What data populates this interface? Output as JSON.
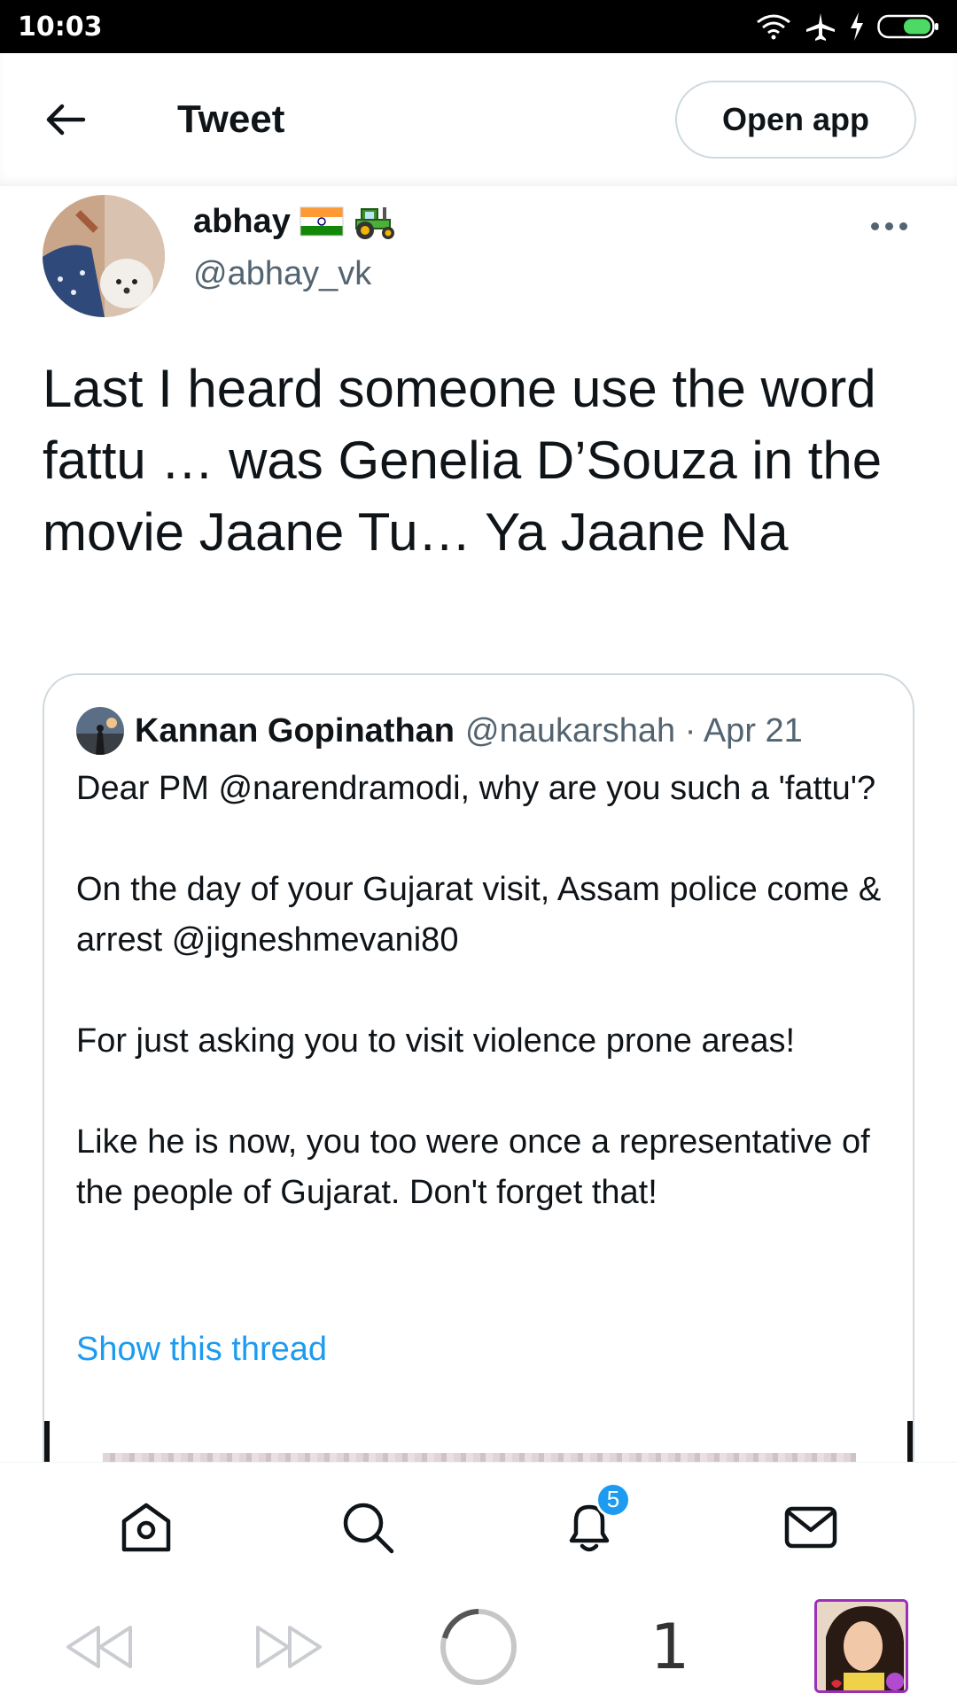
{
  "status_bar": {
    "time": "10:03",
    "icons": [
      "wifi-icon",
      "airplane-icon",
      "charging-icon",
      "battery-icon"
    ]
  },
  "header": {
    "title": "Tweet",
    "open_app_label": "Open app"
  },
  "author": {
    "name": "abhay",
    "handle": "@abhay_vk",
    "badges": [
      "india-flag-emoji",
      "tractor-emoji"
    ]
  },
  "tweet": {
    "text": "Last I heard someone use the word fattu … was Genelia D’Souza in the movie Jaane Tu… Ya Jaane Na"
  },
  "quoted": {
    "name": "Kannan Gopinathan",
    "meta": "@naukarshah · Apr 21",
    "paragraphs": [
      "Dear PM @narendramodi, why are you such a 'fattu'?",
      "On the day of your Gujarat visit, Assam police come & arrest @jigneshmevani80",
      "For just asking you to visit violence prone areas!",
      "Like he is now, you too were once a representative of the people of Gujarat. Don't forget that!"
    ],
    "show_thread": "Show this thread"
  },
  "bottom_nav": {
    "items": [
      "home-icon",
      "search-icon",
      "notifications-icon",
      "messages-icon"
    ],
    "notification_count": "5"
  },
  "browser_bar": {
    "tab_count": "1"
  },
  "colors": {
    "accent": "#1d9bf0",
    "text": "#0f1419",
    "secondary": "#536471",
    "border": "#cfd9de"
  }
}
